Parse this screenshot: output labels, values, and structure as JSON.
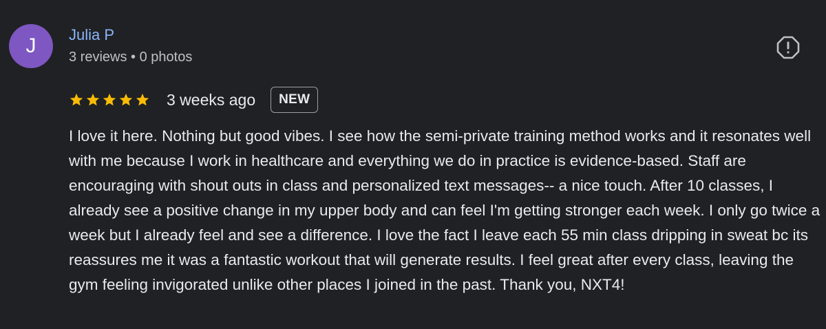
{
  "reviewer": {
    "initial": "J",
    "name": "Julia P",
    "meta": "3 reviews • 0 photos",
    "avatar_color": "#7e57c2"
  },
  "actions": {
    "report_icon": "exclamation-octagon-icon"
  },
  "review": {
    "rating": 5,
    "max_rating": 5,
    "star_color": "#fbbc04",
    "date": "3 weeks ago",
    "badge": "NEW",
    "text": "I love it here. Nothing but good vibes. I see how the semi-private training method works and it resonates well with me because I work in healthcare and everything we do in practice is evidence-based. Staff are encouraging with shout outs in class and personalized text messages-- a nice touch. After 10 classes, I already see a positive change in my upper body and can feel I'm getting stronger each week. I only go twice a week but I already feel and see a difference. I love the fact I leave each 55 min class dripping in sweat bc its reassures me it was a fantastic workout that will generate results. I feel great after every class, leaving the gym feeling invigorated unlike other places I joined in the past. Thank you, NXT4!"
  }
}
